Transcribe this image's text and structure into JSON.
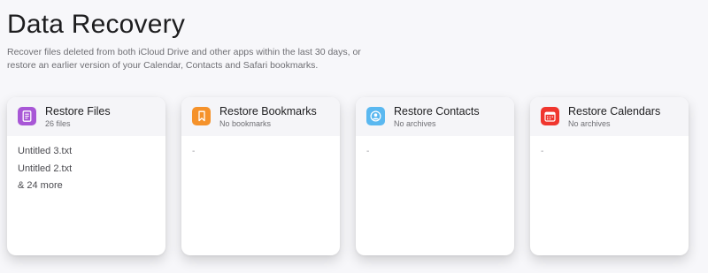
{
  "page": {
    "title": "Data Recovery",
    "description": "Recover files deleted from both iCloud Drive and other apps within the last 30 days, or restore an earlier version of your Calendar, Contacts and Safari bookmarks."
  },
  "cards": [
    {
      "title": "Restore Files",
      "subtitle": "26 files",
      "icon": "document-icon",
      "icon_color": "#a857d6",
      "items": [
        "Untitled 3.txt",
        "Untitled 2.txt"
      ],
      "more": "& 24 more"
    },
    {
      "title": "Restore Bookmarks",
      "subtitle": "No bookmarks",
      "icon": "bookmark-icon",
      "icon_color": "#f5922b",
      "empty": "-"
    },
    {
      "title": "Restore Contacts",
      "subtitle": "No archives",
      "icon": "contact-icon",
      "icon_color": "#5ab8f0",
      "empty": "-"
    },
    {
      "title": "Restore Calendars",
      "subtitle": "No archives",
      "icon": "calendar-icon",
      "icon_color": "#f0362e",
      "empty": "-"
    }
  ]
}
